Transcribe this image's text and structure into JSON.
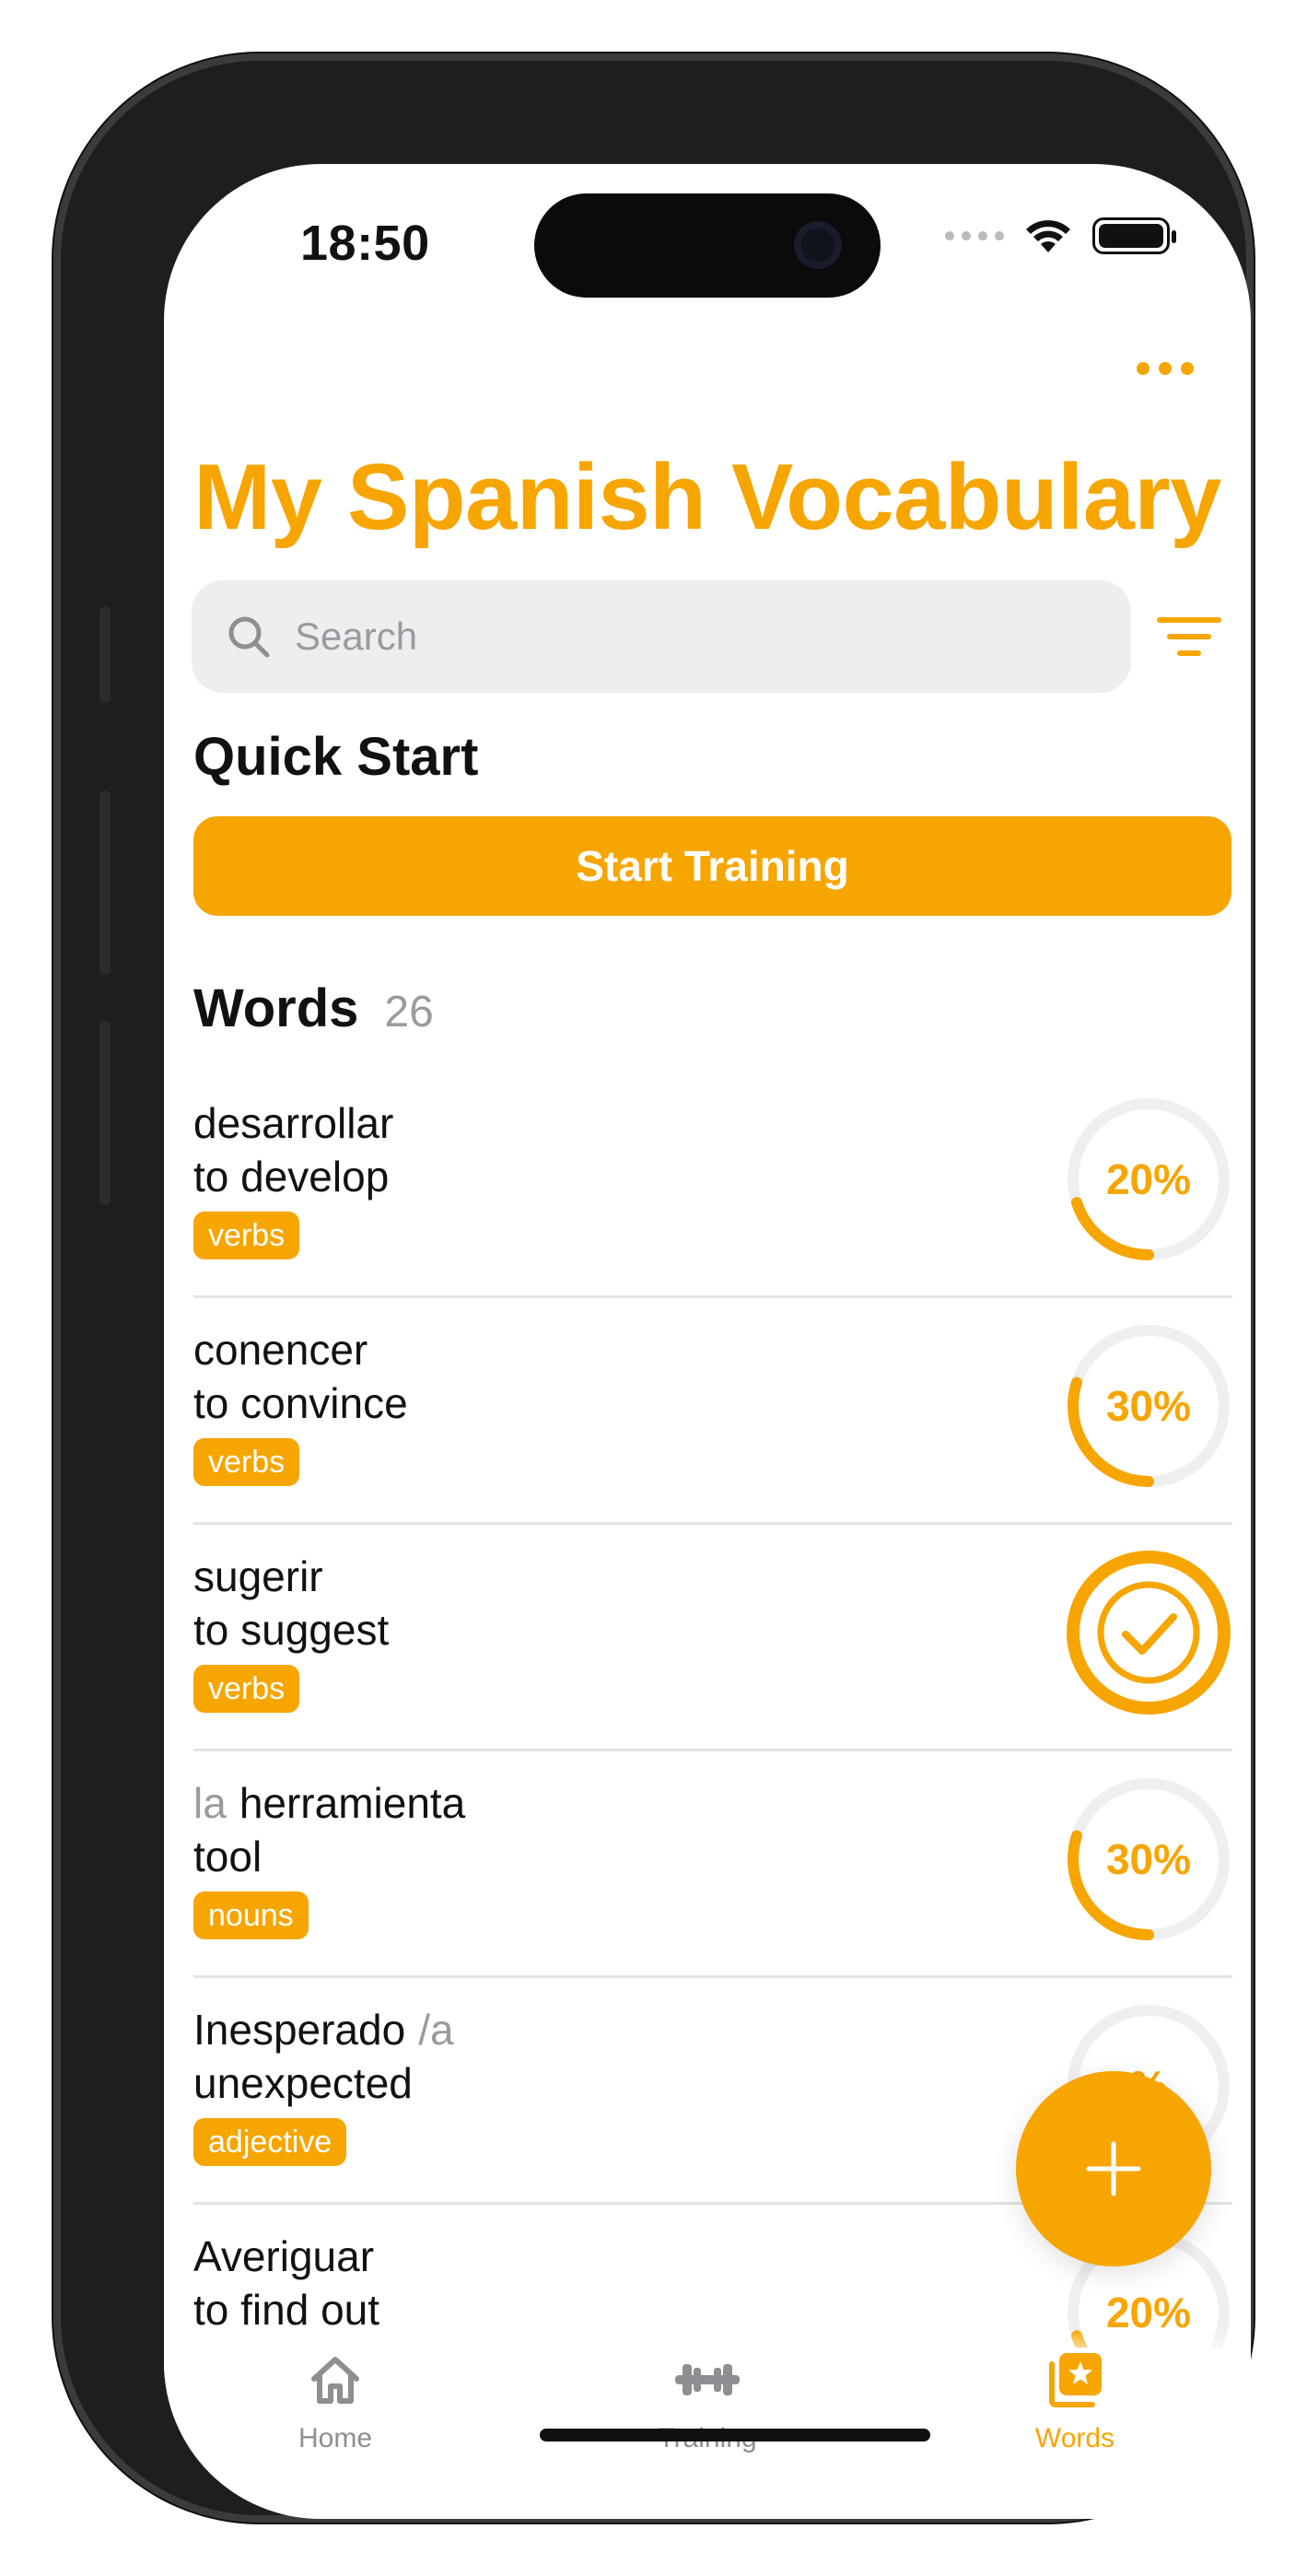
{
  "status_bar": {
    "time": "18:50"
  },
  "header": {
    "title": "My Spanish Vocabulary"
  },
  "search": {
    "placeholder": "Search"
  },
  "quick_start": {
    "title": "Quick Start",
    "button_label": "Start Training"
  },
  "words_section": {
    "title": "Words",
    "count": "26"
  },
  "words": [
    {
      "article": "",
      "word": "desarrollar",
      "suffix": "",
      "translation": "to develop",
      "tag": "verbs",
      "progress": 20,
      "progress_label": "20%",
      "completed": false
    },
    {
      "article": "",
      "word": "conencer",
      "suffix": "",
      "translation": "to convince",
      "tag": "verbs",
      "progress": 30,
      "progress_label": "30%",
      "completed": false
    },
    {
      "article": "",
      "word": "sugerir",
      "suffix": "",
      "translation": "to suggest",
      "tag": "verbs",
      "progress": 100,
      "progress_label": "",
      "completed": true
    },
    {
      "article": "la",
      "word": "herramienta",
      "suffix": "",
      "translation": "tool",
      "tag": "nouns",
      "progress": 30,
      "progress_label": "30%",
      "completed": false
    },
    {
      "article": "",
      "word": "Inesperado",
      "suffix": "/a",
      "translation": "unexpected",
      "tag": "adjective",
      "progress": 10,
      "progress_label": "%",
      "completed": false
    },
    {
      "article": "",
      "word": "Averiguar",
      "suffix": "",
      "translation": "to find out",
      "tag": "",
      "progress": 20,
      "progress_label": "20%",
      "completed": false
    }
  ],
  "tabbar": {
    "items": [
      {
        "label": "Home",
        "icon": "home-icon",
        "active": false
      },
      {
        "label": "Training",
        "icon": "dumbbell-icon",
        "active": false
      },
      {
        "label": "Words",
        "icon": "star-stack-icon",
        "active": true
      }
    ]
  },
  "colors": {
    "accent": "#F7A500",
    "track": "#EFEFF1",
    "divider": "#E3E3E6"
  }
}
